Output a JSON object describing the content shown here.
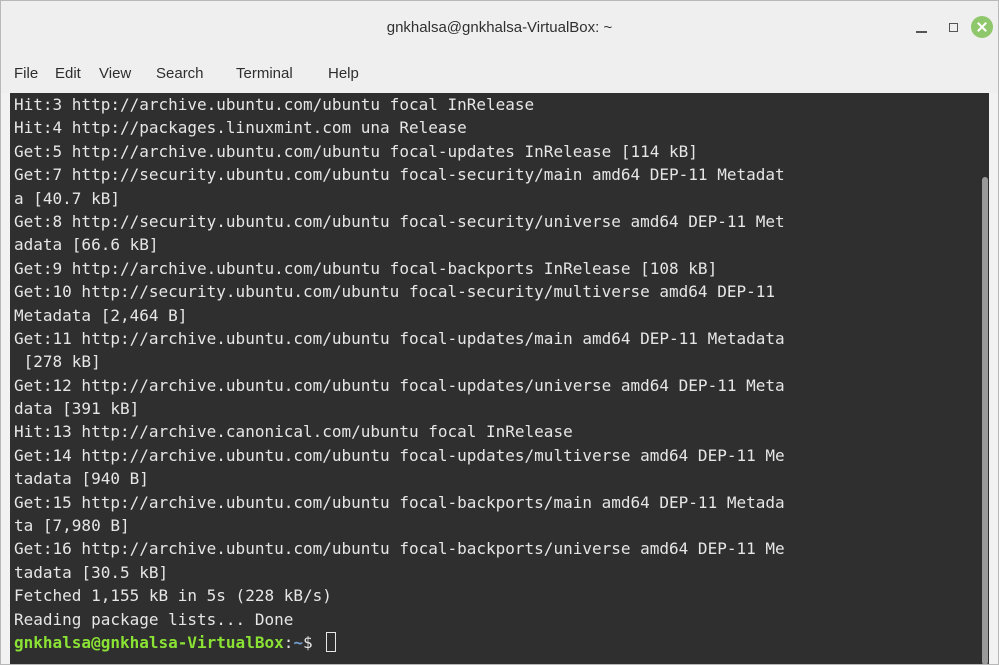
{
  "window": {
    "title": "gnkhalsa@gnkhalsa-VirtualBox: ~",
    "buttons": {
      "minimize": "minimize-icon",
      "maximize": "maximize-icon",
      "close": "close-icon"
    },
    "colors": {
      "close_button": "#8fc76c",
      "terminal_bg": "#2f2f2f",
      "terminal_fg": "#e6e6e6",
      "prompt_user": "#8ae234",
      "prompt_path": "#729fcf"
    }
  },
  "menu": [
    "File",
    "Edit",
    "View",
    "Search",
    "Terminal",
    "Help"
  ],
  "terminal": {
    "lines": [
      "Hit:3 http://archive.ubuntu.com/ubuntu focal InRelease",
      "Hit:4 http://packages.linuxmint.com una Release",
      "Get:5 http://archive.ubuntu.com/ubuntu focal-updates InRelease [114 kB]",
      "Get:7 http://security.ubuntu.com/ubuntu focal-security/main amd64 DEP-11 Metadat",
      "a [40.7 kB]",
      "Get:8 http://security.ubuntu.com/ubuntu focal-security/universe amd64 DEP-11 Met",
      "adata [66.6 kB]",
      "Get:9 http://archive.ubuntu.com/ubuntu focal-backports InRelease [108 kB]",
      "Get:10 http://security.ubuntu.com/ubuntu focal-security/multiverse amd64 DEP-11",
      "Metadata [2,464 B]",
      "Get:11 http://archive.ubuntu.com/ubuntu focal-updates/main amd64 DEP-11 Metadata",
      " [278 kB]",
      "Get:12 http://archive.ubuntu.com/ubuntu focal-updates/universe amd64 DEP-11 Meta",
      "data [391 kB]",
      "Hit:13 http://archive.canonical.com/ubuntu focal InRelease",
      "Get:14 http://archive.ubuntu.com/ubuntu focal-updates/multiverse amd64 DEP-11 Me",
      "tadata [940 B]",
      "Get:15 http://archive.ubuntu.com/ubuntu focal-backports/main amd64 DEP-11 Metada",
      "ta [7,980 B]",
      "Get:16 http://archive.ubuntu.com/ubuntu focal-backports/universe amd64 DEP-11 Me",
      "tadata [30.5 kB]",
      "Fetched 1,155 kB in 5s (228 kB/s)",
      "Reading package lists... Done"
    ],
    "prompt": {
      "user_host": "gnkhalsa@gnkhalsa-VirtualBox",
      "separator": ":",
      "path": "~",
      "symbol": "$ "
    }
  }
}
